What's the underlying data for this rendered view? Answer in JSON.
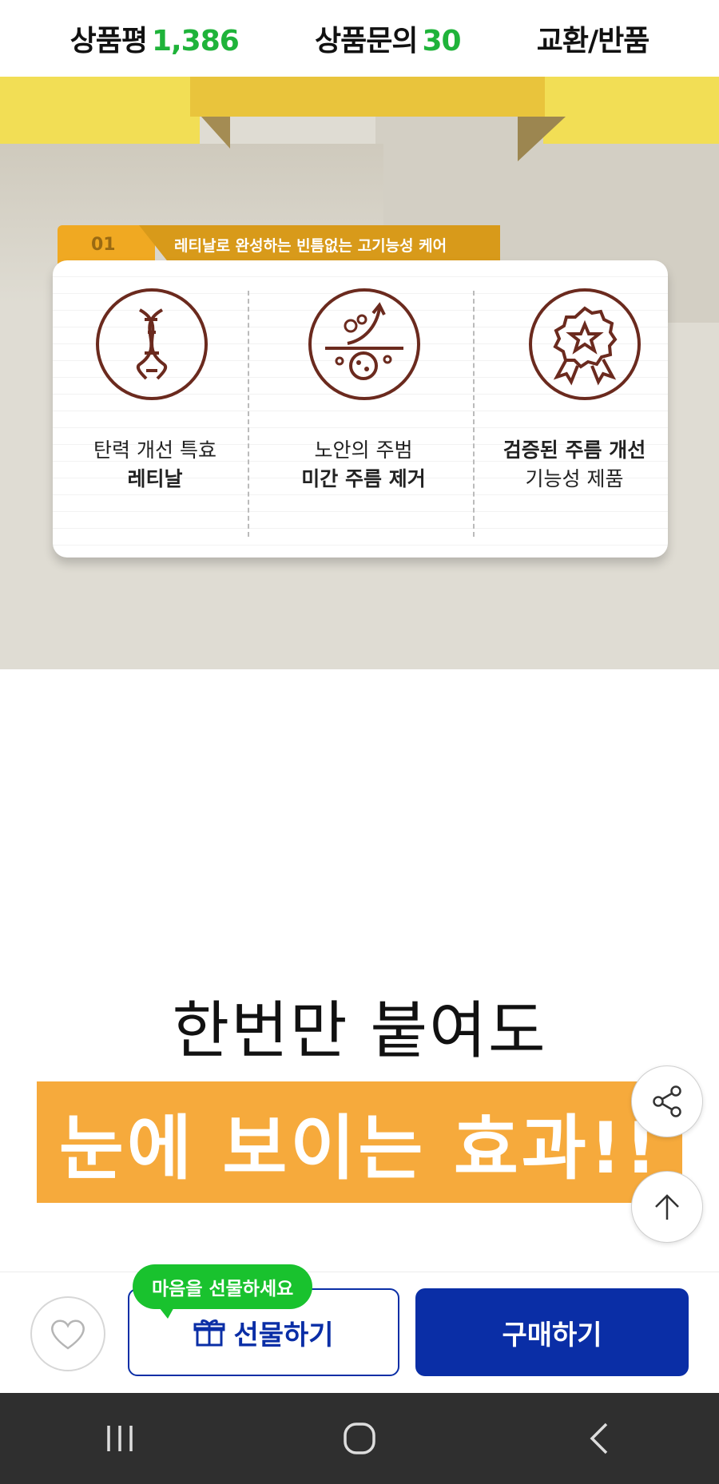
{
  "tabs": [
    {
      "label": "상품평",
      "count": "1,386"
    },
    {
      "label": "상품문의",
      "count": "30"
    },
    {
      "label": "교환/반품",
      "count": ""
    }
  ],
  "feature_section": {
    "badge_number": "01",
    "badge_title": "레티날로 완성하는 빈틈없는 고기능성 케어",
    "items": [
      {
        "icon": "dna-icon",
        "line1": "탄력 개선 특효",
        "line2": "레티날"
      },
      {
        "icon": "skin-lift-icon",
        "line1": "노안의 주범",
        "line2": "미간 주름 제거"
      },
      {
        "icon": "award-badge-icon",
        "line1": "검증된 주름 개선",
        "line2": "기능성 제품"
      }
    ]
  },
  "promo": {
    "headline": "한번만 붙여도",
    "banner": "눈에 보이는 효과!!"
  },
  "bottom_bar": {
    "gift_tooltip": "마음을 선물하세요",
    "gift_label": "선물하기",
    "buy_label": "구매하기"
  },
  "colors": {
    "accent_green": "#1fb33a",
    "primary_blue": "#0a2ea6",
    "banner_orange": "#f6aa3c",
    "icon_brown": "#6b2a1e"
  }
}
